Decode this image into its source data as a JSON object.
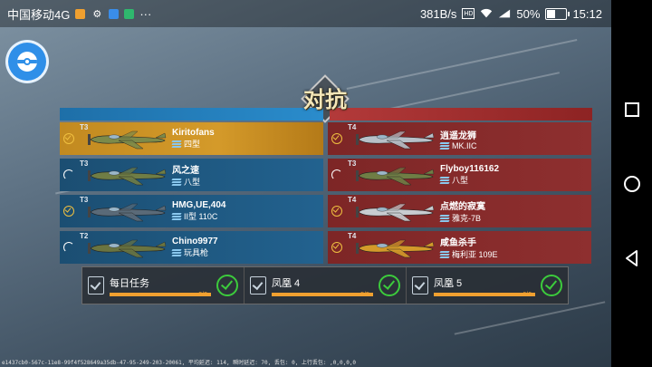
{
  "status_bar": {
    "carrier": "中国移动4G",
    "notif_icons": [
      "app-notif-icon",
      "app-notif-icon",
      "app-notif-icon",
      "app-notif-icon"
    ],
    "more": "···",
    "speed": "381B/s",
    "battery": "50%",
    "battery_level": 0.5,
    "time": "15:12"
  },
  "title": "对抗",
  "colors": {
    "blue_team": "#22628f",
    "red_team": "#8e2f2f",
    "highlight": "#d49a2a",
    "progress": "#f0a030",
    "complete": "#3ccb3c"
  },
  "blue_team": [
    {
      "tier": "T3",
      "name": "Kiritofans",
      "type": "四型",
      "ready": true,
      "highlight": true,
      "plane_color": "#7c8a4a"
    },
    {
      "tier": "T3",
      "name": "风之速",
      "type": "八型",
      "ready": false,
      "highlight": false,
      "plane_color": "#6f7d45"
    },
    {
      "tier": "T3",
      "name": "HMG,UE,404",
      "type": "II型 110C",
      "ready": true,
      "highlight": false,
      "plane_color": "#5a6a78"
    },
    {
      "tier": "T2",
      "name": "Chino9977",
      "type": "玩具枪",
      "ready": false,
      "highlight": false,
      "plane_color": "#6a7440"
    }
  ],
  "red_team": [
    {
      "tier": "T4",
      "name": "逍遥龙狮",
      "type": "MK.IIC",
      "ready": true,
      "plane_color": "#b8c0c8"
    },
    {
      "tier": "T3",
      "name": "Flyboy116162",
      "type": "八型",
      "ready": false,
      "plane_color": "#6f7d45"
    },
    {
      "tier": "T4",
      "name": "点燃的寂寞",
      "type": "雅克-7B",
      "ready": true,
      "plane_color": "#c8ccd0"
    },
    {
      "tier": "T4",
      "name": "咸鱼杀手",
      "type": "梅利亚 109E",
      "ready": true,
      "plane_color": "#d49a2a"
    }
  ],
  "quests": [
    {
      "title": "每日任务",
      "count": "3/3",
      "progress": 1.0
    },
    {
      "title": "凤凰 4",
      "count": "5/5",
      "progress": 1.0
    },
    {
      "title": "凤凰 5",
      "count": "6/6",
      "progress": 1.0
    }
  ],
  "debug_text": "e1437cb0-567c-11e8-99f4f528649a35db-47-95-249-203-20061, 平均延迟: 114, 瞬时延迟: 70, 丢包: 0, 上行丢包: ,0,0,0,0"
}
